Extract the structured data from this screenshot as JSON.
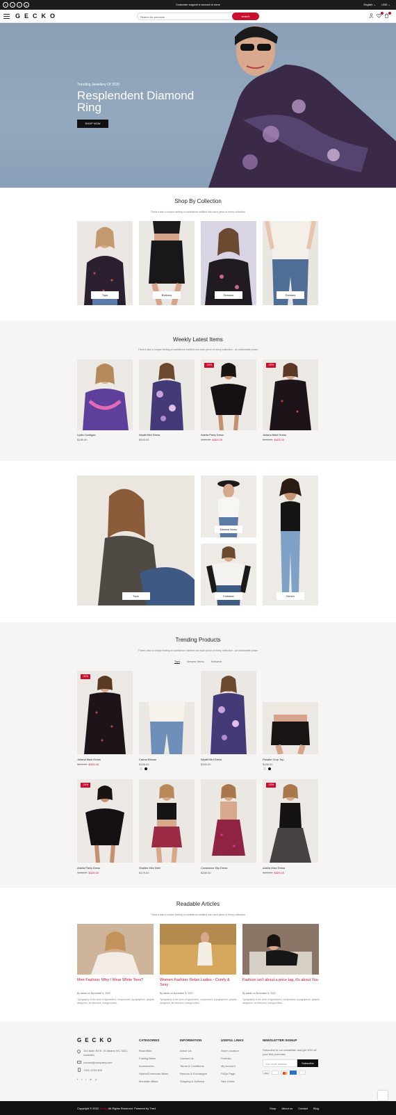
{
  "topbar": {
    "message": "Customer support a second to none",
    "language": "English ⌄",
    "currency": "USD ⌄",
    "social": [
      "f",
      "t",
      "i",
      "p"
    ]
  },
  "header": {
    "logo": "GECKO",
    "search_placeholder": "Search for products",
    "search_button": "search"
  },
  "hero": {
    "subtitle": "Trending Jewellery Of 2020",
    "title": "Resplendent Diamond Ring",
    "button": "SHOP NOW"
  },
  "collection": {
    "title": "Shop By Collection",
    "subtitle": "There's also a unique feeling of confidence instilled into each piece of every collection",
    "items": [
      {
        "label": "Tops"
      },
      {
        "label": "Bottoms"
      },
      {
        "label": "Dresses"
      },
      {
        "label": "Dresses"
      }
    ]
  },
  "weekly": {
    "title": "Weekly Latest Items",
    "subtitle": "There's also a unique feeling of confidence instilled into each piece of every collection - an undeniable power",
    "items": [
      {
        "name": "Lydia Cardigan",
        "price": "$189.00",
        "old": "",
        "new": "",
        "badge": ""
      },
      {
        "name": "Wyatt Mini Dress",
        "price": "$349.00",
        "old": "",
        "new": "",
        "badge": ""
      },
      {
        "name": "Adelia Party Dress",
        "price": "",
        "old": "$435.00",
        "new": "$329.00",
        "badge": "-24%"
      },
      {
        "name": "Juliana Maxi Dress",
        "price": "",
        "old": "$599.00",
        "new": "$403.00",
        "badge": "-32%"
      }
    ]
  },
  "banners": {
    "items": [
      {
        "label": "Tops"
      },
      {
        "label": "Newest Items"
      },
      {
        "label": "Knitwear"
      },
      {
        "label": "Denim"
      }
    ]
  },
  "trending": {
    "title": "Trending Products",
    "subtitle": "There's also a unique feeling of confidence instilled into each piece of every collection - an undeniable power",
    "tabs": [
      "Tops",
      "Newest Items",
      "Knitwear"
    ],
    "items": [
      {
        "name": "Juliana Maxi Dress",
        "price": "",
        "old": "$599.00",
        "new": "$403.00",
        "badge": "-33%"
      },
      {
        "name": "Carina Blouse",
        "price": "$158.00",
        "old": "",
        "new": "",
        "badge": ""
      },
      {
        "name": "Wyatt Mini Dress",
        "price": "$349.00",
        "old": "",
        "new": "",
        "badge": ""
      },
      {
        "name": "Rosalie Crop Top",
        "price": "$158.00",
        "old": "",
        "new": "",
        "badge": ""
      },
      {
        "name": "Adelia Party Dress",
        "price": "",
        "old": "$435.00",
        "new": "$329.00",
        "badge": "-24%"
      },
      {
        "name": "Shallee Mini Skirt",
        "price": "$179.00",
        "old": "",
        "new": "",
        "badge": ""
      },
      {
        "name": "Constance Slip Dress",
        "price": "$289.00",
        "old": "",
        "new": "",
        "badge": ""
      },
      {
        "name": "Adelia Maxi Dress",
        "price": "",
        "old": "$435.00",
        "new": "$329.00",
        "badge": "-33%"
      }
    ]
  },
  "articles": {
    "title": "Readable Articles",
    "subtitle": "There's also a unique feeling of confidence instilled into each piece of every collection",
    "items": [
      {
        "title": "Men Fashion: Why I Wear White Tees?",
        "meta": "By admin on November 5, 2022",
        "excerpt": "Typography is the work of typesetters, compositors, typographers, graphic designers, art directors, manga artists,..."
      },
      {
        "title": "Women Fashion: Relax Ladies - Comfy & Sexy",
        "meta": "By admin on November 5, 2022",
        "excerpt": "Typography is the work of typesetters, compositors, typographers, graphic designers, art directors, manga artists,..."
      },
      {
        "title": "Fashion isn't about a price tag, it's about You",
        "meta": "By admin on November 5, 2022",
        "excerpt": "Typography is the work of typesetters, compositors, typographers, graphic designers, art directors, manga artists,..."
      }
    ]
  },
  "footer": {
    "logo": "GECKO",
    "address": "164 Main Rd E, St Albans VIC 3021, Australia",
    "email": "contact@company.com",
    "phone": "+001 2233 456",
    "categories": {
      "title": "CATEGORIES",
      "links": [
        "Road Bike",
        "Folding Bikes",
        "Accessories",
        "Hybrid/Commuter Bikes",
        "Mountain Bikes"
      ]
    },
    "information": {
      "title": "INFORMATION",
      "links": [
        "About Us",
        "Contact Us",
        "Terms & Conditions",
        "Returns & Exchanges",
        "Shipping & Delivery"
      ]
    },
    "useful": {
      "title": "USEFUL LINKS",
      "links": [
        "Store Location",
        "Portfolio",
        "My Account",
        "FAQs Page",
        "Size Guide"
      ]
    },
    "newsletter": {
      "title": "NEWSLETTER SIGNUP",
      "text": "Subscribe to our newsletter and get 10% off your first purchase",
      "placeholder": "Your email address",
      "button": "Subscribe"
    }
  },
  "bottom": {
    "copyright_pre": "Copyright © 2022 ",
    "brand": "Gecko",
    "copyright_post": " All Rights Reserved. Powered by ",
    "powered": "The4",
    "links": [
      "Shop",
      "About us",
      "Contact",
      "Blog"
    ]
  },
  "colors": {
    "accent": "#c8102e",
    "dark": "#111111",
    "section_bg": "#f6f5f3"
  }
}
